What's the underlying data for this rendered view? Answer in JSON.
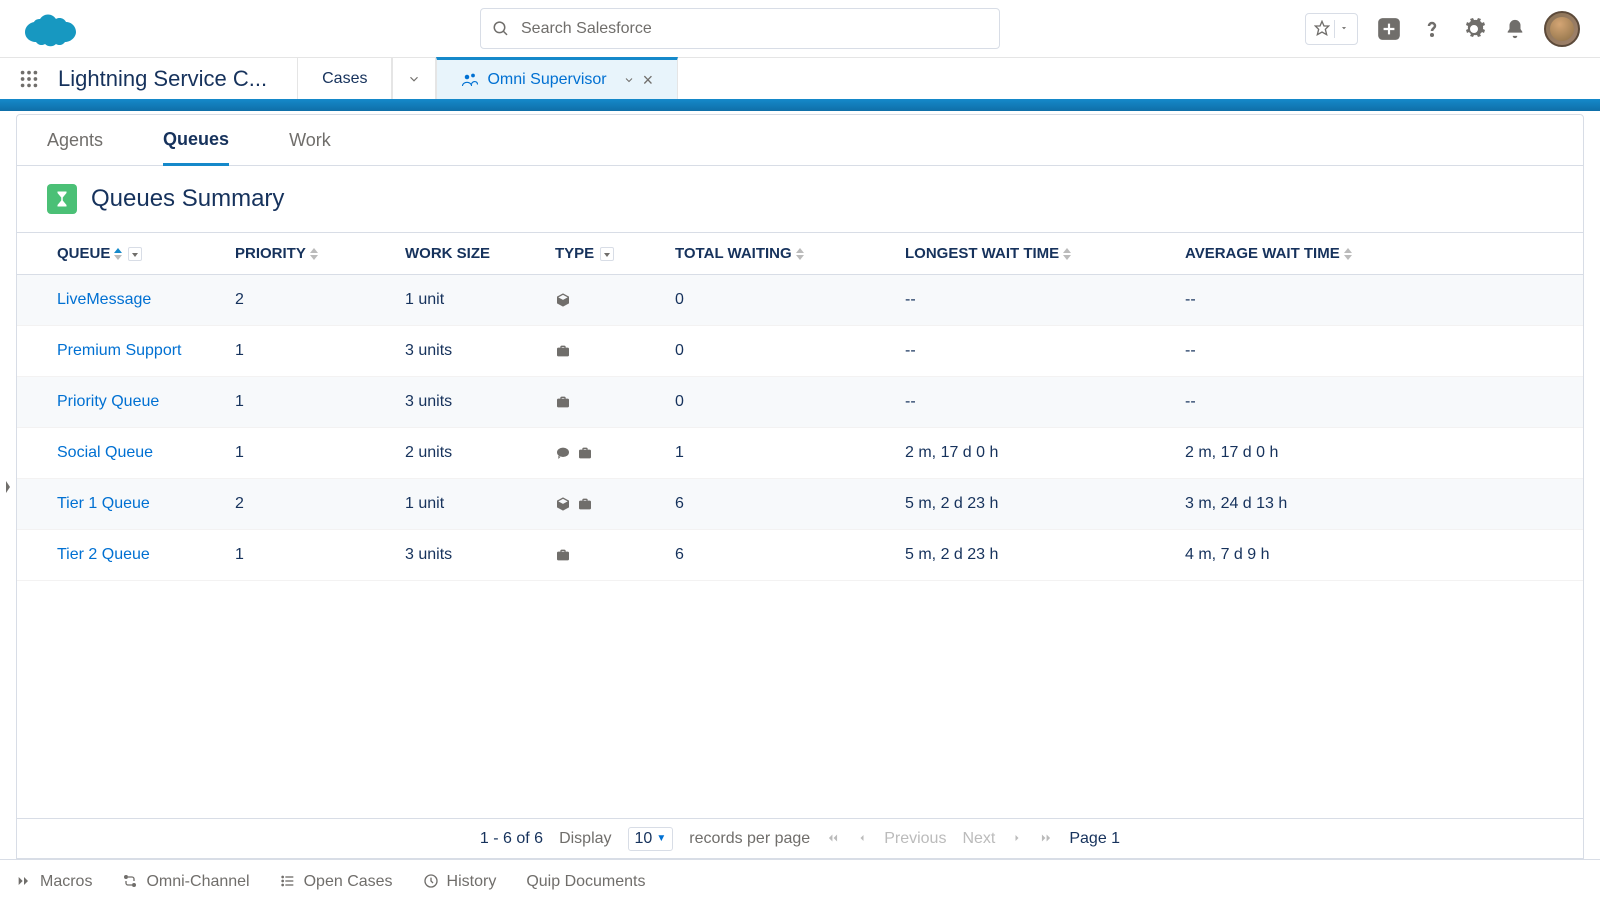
{
  "header": {
    "search_placeholder": "Search Salesforce"
  },
  "nav": {
    "app_name": "Lightning Service C...",
    "tabs": [
      {
        "label": "Cases"
      },
      {
        "label": "Omni Supervisor"
      }
    ]
  },
  "inner_tabs": {
    "items": [
      "Agents",
      "Queues",
      "Work"
    ],
    "active": 1
  },
  "page": {
    "title": "Queues Summary"
  },
  "columns": {
    "queue": "QUEUE",
    "priority": "PRIORITY",
    "work_size": "WORK SIZE",
    "type": "TYPE",
    "total_waiting": "TOTAL WAITING",
    "longest": "LONGEST WAIT TIME",
    "average": "AVERAGE WAIT TIME"
  },
  "rows": [
    {
      "queue": "LiveMessage",
      "priority": "2",
      "work_size": "1 unit",
      "types": [
        "box"
      ],
      "total": "0",
      "longest": "--",
      "average": "--"
    },
    {
      "queue": "Premium Support",
      "priority": "1",
      "work_size": "3 units",
      "types": [
        "case"
      ],
      "total": "0",
      "longest": "--",
      "average": "--"
    },
    {
      "queue": "Priority Queue",
      "priority": "1",
      "work_size": "3 units",
      "types": [
        "case"
      ],
      "total": "0",
      "longest": "--",
      "average": "--"
    },
    {
      "queue": "Social Queue",
      "priority": "1",
      "work_size": "2 units",
      "types": [
        "chat",
        "case"
      ],
      "total": "1",
      "longest": "2 m, 17 d 0 h",
      "average": "2 m, 17 d 0 h"
    },
    {
      "queue": "Tier 1 Queue",
      "priority": "2",
      "work_size": "1 unit",
      "types": [
        "box",
        "case"
      ],
      "total": "6",
      "longest": "5 m, 2 d 23 h",
      "average": "3 m, 24 d 13 h"
    },
    {
      "queue": "Tier 2 Queue",
      "priority": "1",
      "work_size": "3 units",
      "types": [
        "case"
      ],
      "total": "6",
      "longest": "5 m, 2 d 23 h",
      "average": "4 m, 7 d 9 h"
    }
  ],
  "pager": {
    "range": "1 - 6 of 6",
    "display": "Display",
    "per_page_value": "10",
    "records": "records per page",
    "previous": "Previous",
    "next": "Next",
    "page": "Page 1"
  },
  "footer": {
    "items": [
      "Macros",
      "Omni-Channel",
      "Open Cases",
      "History",
      "Quip Documents"
    ]
  }
}
